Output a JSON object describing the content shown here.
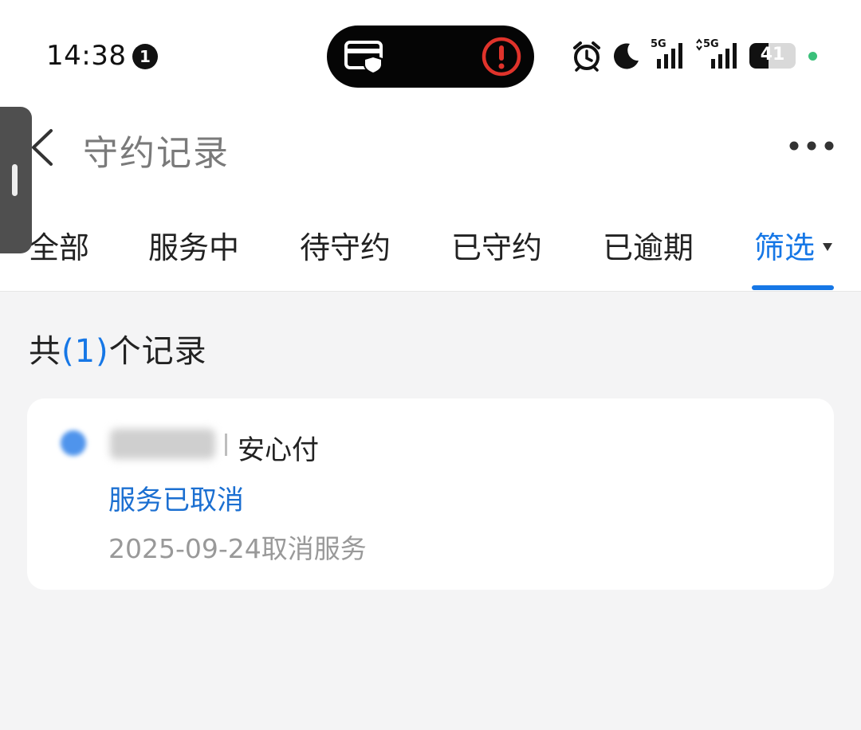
{
  "status_bar": {
    "time": "14:38",
    "notification_count": "1",
    "network_1": "5G",
    "network_2": "5G",
    "battery_level": "41",
    "battery_fraction": 0.41
  },
  "nav": {
    "title": "守约记录"
  },
  "tabs": [
    {
      "label": "全部"
    },
    {
      "label": "服务中"
    },
    {
      "label": "待守约"
    },
    {
      "label": "已守约"
    },
    {
      "label": "已逾期"
    },
    {
      "label": "筛选",
      "active": true
    }
  ],
  "summary": {
    "prefix": "共",
    "count": "(1)",
    "suffix": "个记录"
  },
  "records": [
    {
      "service_name": "安心付",
      "status": "服务已取消",
      "detail": "2025-09-24取消服务"
    }
  ],
  "colors": {
    "accent": "#1677e6",
    "status_text": "#1b6fd1",
    "background": "#f4f4f5",
    "alert": "#e0332b"
  },
  "icons": [
    "card-shield-icon",
    "alert-icon",
    "alarm-icon",
    "moon-icon",
    "signal-icon",
    "battery-icon",
    "back-arrow-icon",
    "more-icon",
    "caret-down-icon"
  ]
}
